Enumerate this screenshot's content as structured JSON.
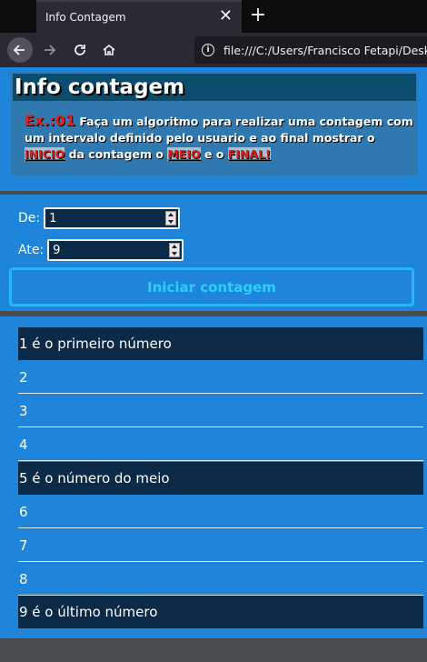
{
  "browser": {
    "tab_title": "Info Contagem",
    "tab_close": "✕",
    "new_tab": "+",
    "url": "file:///C:/Users/Francisco Fetapi/Deskt"
  },
  "info": {
    "title": "Info contagem",
    "ex_label": "Ex.:01",
    "text_part1": " Faça um algoritmo para realizar uma contagem com um intervalo definido pelo usuario e ao final mostrar o ",
    "inicio": "INICIO",
    "text_part2": " da contagem o ",
    "meio": "MEIO",
    "text_part3": " e o ",
    "final": "FINAL!"
  },
  "form": {
    "de_label": "De:",
    "de_value": "1",
    "ate_label": "Ate:",
    "ate_value": "9",
    "button_label": "Iniciar contagem"
  },
  "results": [
    {
      "text": "1 é o primeiro número",
      "highlight": true
    },
    {
      "text": "2",
      "highlight": false
    },
    {
      "text": "3",
      "highlight": false
    },
    {
      "text": "4",
      "highlight": false
    },
    {
      "text": "5 é o número do meio",
      "highlight": true
    },
    {
      "text": "6",
      "highlight": false
    },
    {
      "text": "7",
      "highlight": false
    },
    {
      "text": "8",
      "highlight": false
    },
    {
      "text": "9 é o último número",
      "highlight": true
    }
  ],
  "colors": {
    "page_bg": "#1f85db",
    "dark_row": "#0b2a48",
    "accent_red": "#e02020",
    "button_text": "#29d0ff"
  }
}
